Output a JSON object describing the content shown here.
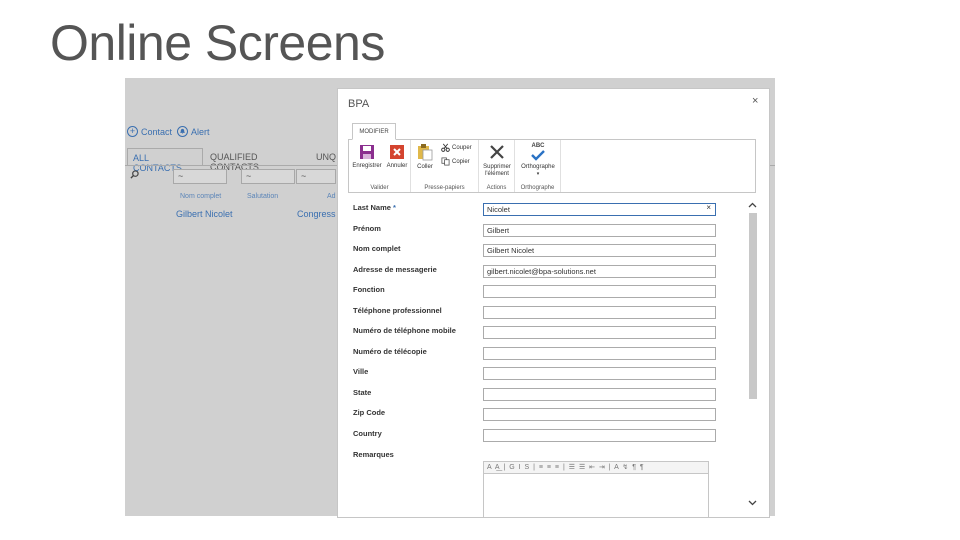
{
  "slide": {
    "title": "Online Screens"
  },
  "list": {
    "actions": [
      {
        "label": "Contact",
        "icon": "plus-icon"
      },
      {
        "label": "Alert",
        "icon": "bell-icon"
      }
    ],
    "tabs": [
      "ALL CONTACTS",
      "QUALIFIED CONTACTS",
      "UNQ"
    ],
    "filter_caret": "~",
    "columns": [
      "Nom complet",
      "Salutation",
      "Ad"
    ],
    "row": [
      "Gilbert Nicolet",
      "Congress"
    ]
  },
  "dialog": {
    "title": "BPA",
    "close": "×",
    "ribbon": {
      "tab": "MODIFIER",
      "groups": {
        "valider": {
          "label": "Valider",
          "save": "Enregistrer",
          "cancel": "Annuler"
        },
        "clipboard": {
          "label": "Presse-papiers",
          "paste": "Coller",
          "cut": "Couper",
          "copy": "Copier"
        },
        "actions": {
          "label": "Actions",
          "delete_line1": "Supprimer",
          "delete_line2": "l'élément"
        },
        "spelling": {
          "label": "Orthographe",
          "abc": "ABC",
          "button": "Orthographe"
        }
      }
    },
    "form": {
      "required_marker": "*",
      "fields": [
        {
          "label": "Last Name",
          "value": "Nicolet"
        },
        {
          "label": "Prénom",
          "value": "Gilbert"
        },
        {
          "label": "Nom complet",
          "value": "Gilbert Nicolet"
        },
        {
          "label": "Adresse de messagerie",
          "value": "gilbert.nicolet@bpa-solutions.net"
        },
        {
          "label": "Fonction",
          "value": ""
        },
        {
          "label": "Téléphone professionnel",
          "value": ""
        },
        {
          "label": "Numéro de téléphone mobile",
          "value": ""
        },
        {
          "label": "Numéro de télécopie",
          "value": ""
        },
        {
          "label": "Ville",
          "value": ""
        },
        {
          "label": "State",
          "value": ""
        },
        {
          "label": "Zip Code",
          "value": ""
        },
        {
          "label": "Country",
          "value": ""
        },
        {
          "label": "Remarques",
          "value": ""
        }
      ],
      "clear": "×",
      "rte_toolbar": "A A͟ | G I S | ≡ ≡ ≡ | ☰ ☰ ⇤ ⇥ | A ↯ ¶ ¶"
    }
  }
}
